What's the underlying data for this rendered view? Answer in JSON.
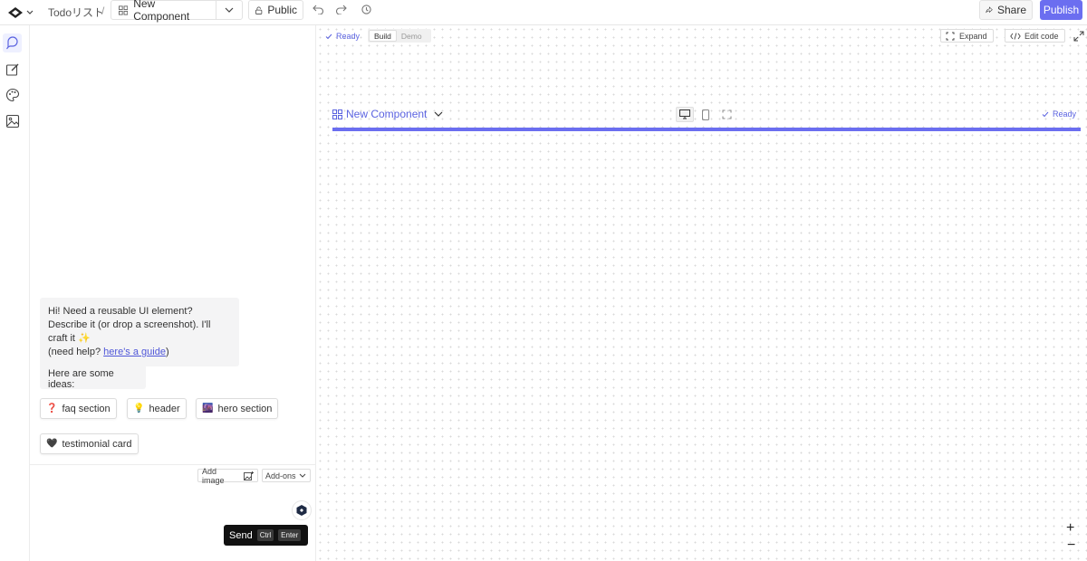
{
  "topbar": {
    "project": "Todoリスト",
    "separator": "/",
    "component_name": "New Component",
    "visibility": "Public",
    "share": "Share",
    "publish": "Publish"
  },
  "rail": {
    "items": [
      "chat-icon",
      "edit-icon",
      "palette-icon",
      "image-icon"
    ]
  },
  "chat": {
    "greeting_1": "Hi! Need a reusable UI element? Describe it (or drop a screenshot). I'll craft it ✨",
    "greeting_2": "(need help? ",
    "guide_link": "here's a guide",
    "greeting_3": ")",
    "ideas_intro": "Here are some ideas:",
    "ideas": [
      {
        "emoji": "❓",
        "label": "faq section"
      },
      {
        "emoji": "💡",
        "label": "header"
      },
      {
        "emoji": "🌆",
        "label": "hero section"
      },
      {
        "emoji": "🖤",
        "label": "testimonial card"
      }
    ],
    "add_image": "Add image",
    "addons": "Add-ons",
    "send": "Send",
    "send_key_1": "Ctrl",
    "send_key_2": "Enter"
  },
  "canvas": {
    "status": "Ready",
    "mode_build": "Build",
    "mode_demo": "Demo",
    "expand": "Expand",
    "edit_code": "Edit code",
    "preview_title": "New Component",
    "preview_status": "Ready",
    "zoom_in": "+",
    "zoom_out": "−"
  },
  "colors": {
    "accent": "#6b6ef0",
    "accent_text": "#5b63e0"
  }
}
